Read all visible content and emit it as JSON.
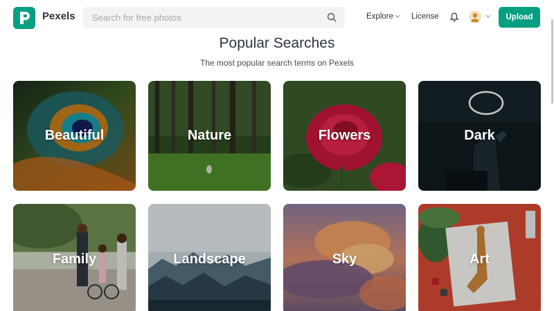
{
  "header": {
    "brand": "Pexels",
    "search": {
      "placeholder": "Search for free photos"
    },
    "nav": {
      "explore": "Explore",
      "license": "License"
    },
    "upload_label": "Upload",
    "icons": [
      "pexels-logo-icon",
      "search-icon",
      "chevron-down-icon",
      "bell-icon",
      "avatar",
      "upload-button"
    ]
  },
  "section": {
    "title": "Popular Searches",
    "subtitle": "The most popular search terms on Pexels"
  },
  "tiles": [
    {
      "label": "Beautiful"
    },
    {
      "label": "Nature"
    },
    {
      "label": "Flowers"
    },
    {
      "label": "Dark"
    },
    {
      "label": "Family"
    },
    {
      "label": "Landscape"
    },
    {
      "label": "Sky"
    },
    {
      "label": "Art"
    }
  ],
  "colors": {
    "brand": "#05a081",
    "text": "#2c343e"
  }
}
